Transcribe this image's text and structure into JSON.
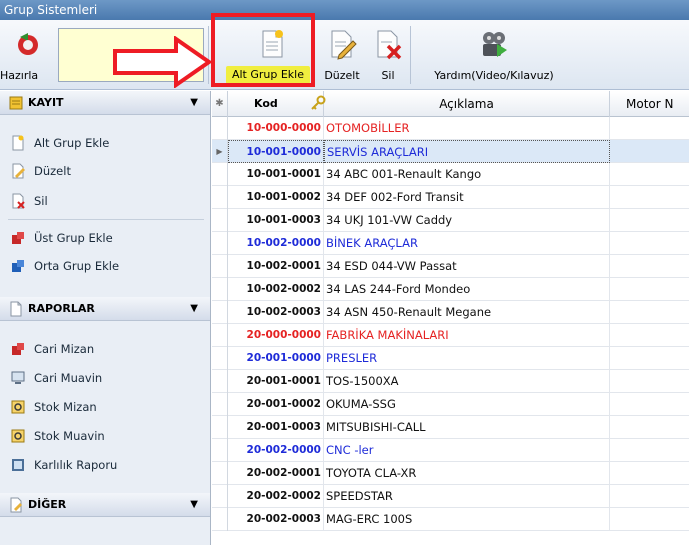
{
  "window": {
    "title": "Grup Sistemleri"
  },
  "toolbar": {
    "hazirla_label": "Hazırla",
    "alt_grup_label": "Alt Grup Ekle",
    "duzelt_label": "Düzelt",
    "sil_label": "Sil",
    "yardim_label": "Yardım(Video/Kılavuz)"
  },
  "sidebar": {
    "kayit": {
      "title": "KAYIT",
      "items": [
        "Alt Grup Ekle",
        "Düzelt",
        "Sil",
        "Üst Grup Ekle",
        "Orta Grup Ekle"
      ]
    },
    "raporlar": {
      "title": "RAPORLAR",
      "items": [
        "Cari Mizan",
        "Cari Muavin",
        "Stok Mizan",
        "Stok Muavin",
        "Karlılık Raporu"
      ]
    },
    "diger": {
      "title": "DİĞER"
    }
  },
  "grid": {
    "columns": {
      "kod": "Kod",
      "aciklama": "Açıklama",
      "motor": "Motor N"
    },
    "rows": [
      {
        "kod": "10-000-0000",
        "aciklama": "OTOMOBİLLER",
        "color": "#e52222"
      },
      {
        "kod": "10-001-0000",
        "aciklama": "SERVİS ARAÇLARI",
        "color": "#1e2bd8",
        "selected": true
      },
      {
        "kod": "10-001-0001",
        "aciklama": "34 ABC 001-Renault Kango",
        "color": "#111111"
      },
      {
        "kod": "10-001-0002",
        "aciklama": "34 DEF 002-Ford Transit",
        "color": "#111111"
      },
      {
        "kod": "10-001-0003",
        "aciklama": "34 UKJ 101-VW Caddy",
        "color": "#111111"
      },
      {
        "kod": "10-002-0000",
        "aciklama": "BİNEK ARAÇLAR",
        "color": "#1e2bd8"
      },
      {
        "kod": "10-002-0001",
        "aciklama": "34 ESD 044-VW Passat",
        "color": "#111111"
      },
      {
        "kod": "10-002-0002",
        "aciklama": "34 LAS 244-Ford Mondeo",
        "color": "#111111"
      },
      {
        "kod": "10-002-0003",
        "aciklama": "34 ASN 450-Renault Megane",
        "color": "#111111"
      },
      {
        "kod": "20-000-0000",
        "aciklama": "FABRİKA MAKİNALARI",
        "color": "#e52222"
      },
      {
        "kod": "20-001-0000",
        "aciklama": "PRESLER",
        "color": "#1e2bd8"
      },
      {
        "kod": "20-001-0001",
        "aciklama": "TOS-1500XA",
        "color": "#111111"
      },
      {
        "kod": "20-001-0002",
        "aciklama": "OKUMA-SSG",
        "color": "#111111"
      },
      {
        "kod": "20-001-0003",
        "aciklama": "MITSUBISHI-CALL",
        "color": "#111111"
      },
      {
        "kod": "20-002-0000",
        "aciklama": "CNC -ler",
        "color": "#1e2bd8"
      },
      {
        "kod": "20-002-0001",
        "aciklama": "TOYOTA CLA-XR",
        "color": "#111111"
      },
      {
        "kod": "20-002-0002",
        "aciklama": "SPEEDSTAR",
        "color": "#111111"
      },
      {
        "kod": "20-002-0003",
        "aciklama": "MAG-ERC 100S",
        "color": "#111111"
      }
    ]
  },
  "colors": {
    "title_bar": "#4a79ae",
    "highlight_label": "#f0ee3f",
    "annotation_red": "#ee1c24",
    "group_red": "#e52222",
    "group_blue": "#1e2bd8"
  }
}
